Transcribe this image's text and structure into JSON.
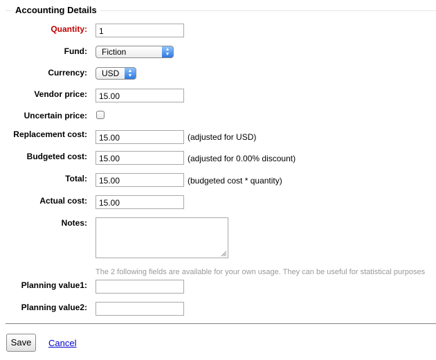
{
  "section": {
    "title": "Accounting Details"
  },
  "fields": {
    "quantity": {
      "label": "Quantity:",
      "value": "1"
    },
    "fund": {
      "label": "Fund:",
      "selected": "Fiction"
    },
    "currency": {
      "label": "Currency:",
      "selected": "USD"
    },
    "vendor_price": {
      "label": "Vendor price:",
      "value": "15.00"
    },
    "uncertain_price": {
      "label": "Uncertain price:",
      "checked": false
    },
    "replacement_cost": {
      "label": "Replacement cost:",
      "value": "15.00",
      "note": "(adjusted for USD)"
    },
    "budgeted_cost": {
      "label": "Budgeted cost:",
      "value": "15.00",
      "note": "(adjusted for 0.00% discount)"
    },
    "total": {
      "label": "Total:",
      "value": "15.00",
      "note": "(budgeted cost * quantity)"
    },
    "actual_cost": {
      "label": "Actual cost:",
      "value": "15.00"
    },
    "notes": {
      "label": "Notes:",
      "value": ""
    },
    "planning_hint": "The 2 following fields are available for your own usage. They can be useful for statistical purposes",
    "planning_value1": {
      "label": "Planning value1:",
      "value": ""
    },
    "planning_value2": {
      "label": "Planning value2:",
      "value": ""
    }
  },
  "actions": {
    "save_label": "Save",
    "cancel_label": "Cancel"
  },
  "colors": {
    "required_label": "#c00000",
    "link": "#0000cc",
    "hint": "#999999",
    "select_accent": "#2d78e0"
  }
}
